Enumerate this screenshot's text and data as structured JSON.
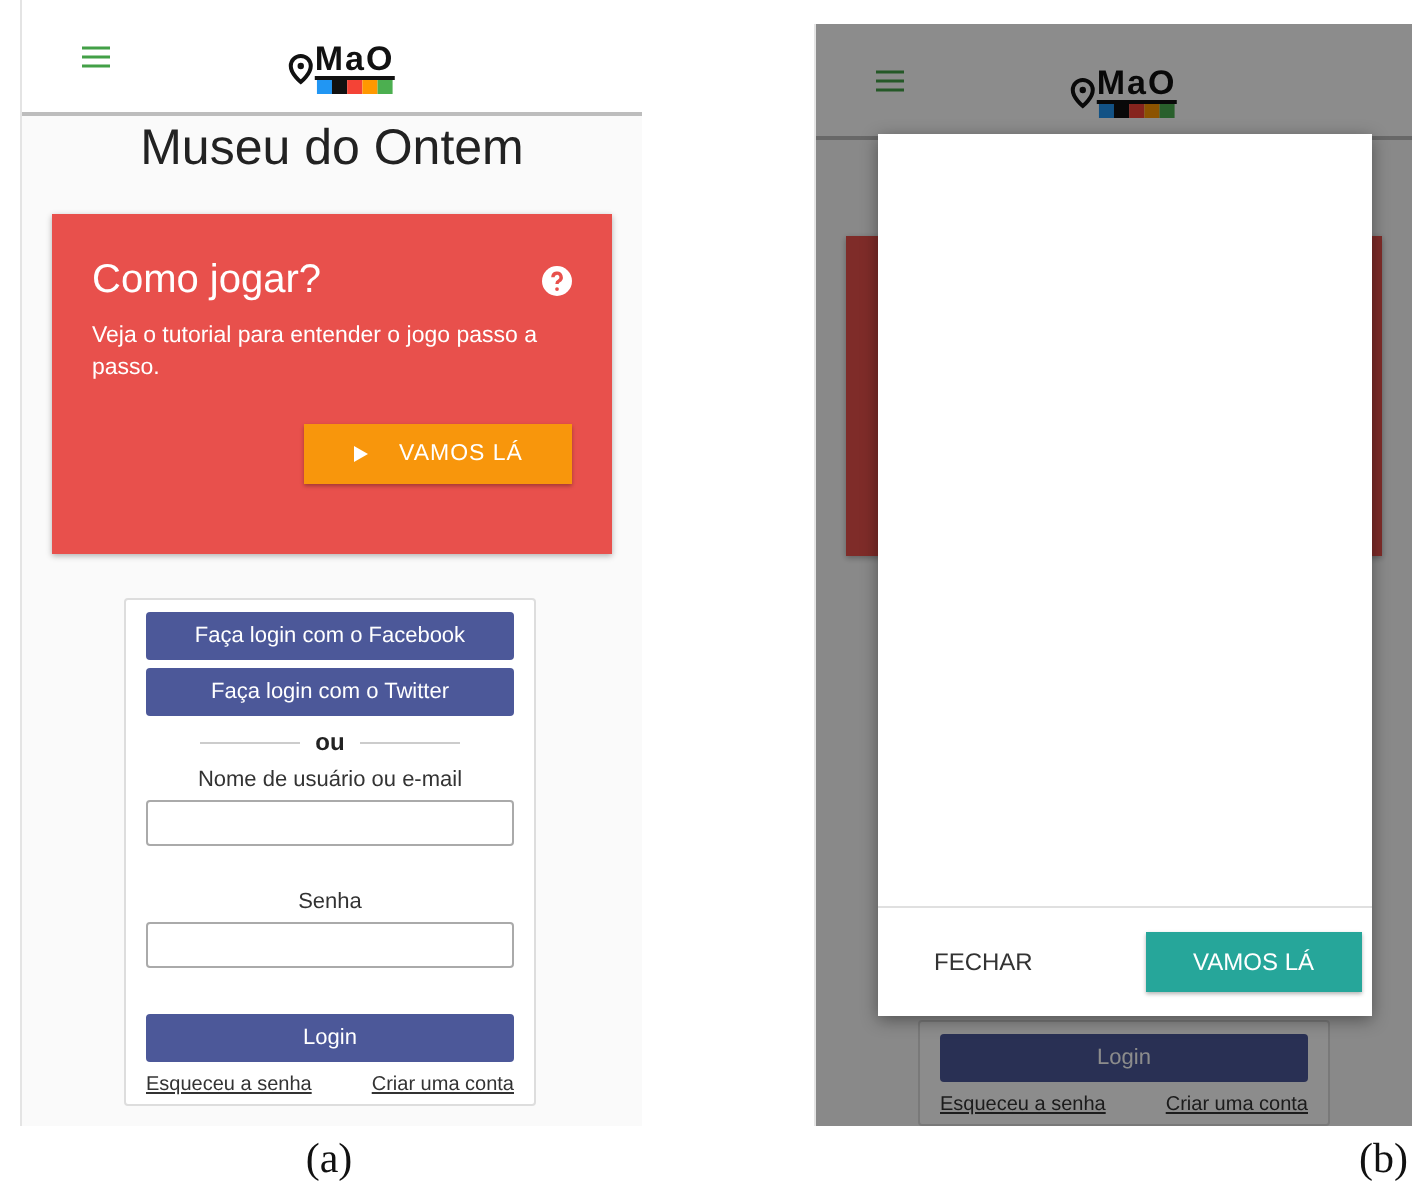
{
  "panels": [
    {
      "caption": "(a)",
      "header": {
        "logo": "MaO"
      },
      "title": "Museu do Ontem",
      "tutorial_card": {
        "title": "Como jogar?",
        "text": "Veja o tutorial para entender o jogo passo a passo.",
        "button": "VAMOS LÁ"
      },
      "login": {
        "facebook_button": "Faça login com o Facebook",
        "twitter_button": "Faça login com o Twitter",
        "divider": "ou",
        "username_label": "Nome de usuário ou e-mail",
        "password_label": "Senha",
        "login_button": "Login",
        "forgot_link": "Esqueceu a senha",
        "signup_link": "Criar uma conta"
      }
    },
    {
      "caption": "(b)",
      "header": {
        "logo": "MaO"
      },
      "login": {
        "login_button": "Login",
        "forgot_link": "Esqueceu a senha",
        "signup_link": "Criar uma conta"
      },
      "dialog": {
        "buttons": [
          {
            "label": "FECHAR",
            "kind": "text"
          },
          {
            "label": "VAMOS LÁ",
            "kind": "primary"
          }
        ]
      }
    }
  ]
}
